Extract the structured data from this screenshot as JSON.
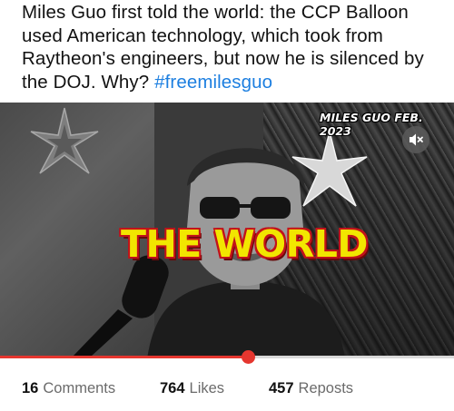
{
  "post": {
    "text": "Miles Guo first told the world: the CCP Balloon used American technology, which took from Raytheon's engineers, but now he is silenced by the DOJ. Why?",
    "hashtag": "#freemilesguo"
  },
  "video": {
    "overlay_title": "MILES GUO FEB. 2023",
    "caption": "THE WORLD",
    "progress_fraction": 0.545,
    "mute_icon": "speaker-muted-icon",
    "colors": {
      "caption_fill": "#f2e600",
      "caption_outline": "#c2121a",
      "progress": "#e5362f"
    }
  },
  "stats": {
    "comments_count": "16",
    "comments_label": "Comments",
    "likes_count": "764",
    "likes_label": "Likes",
    "reposts_count": "457",
    "reposts_label": "Reposts"
  }
}
